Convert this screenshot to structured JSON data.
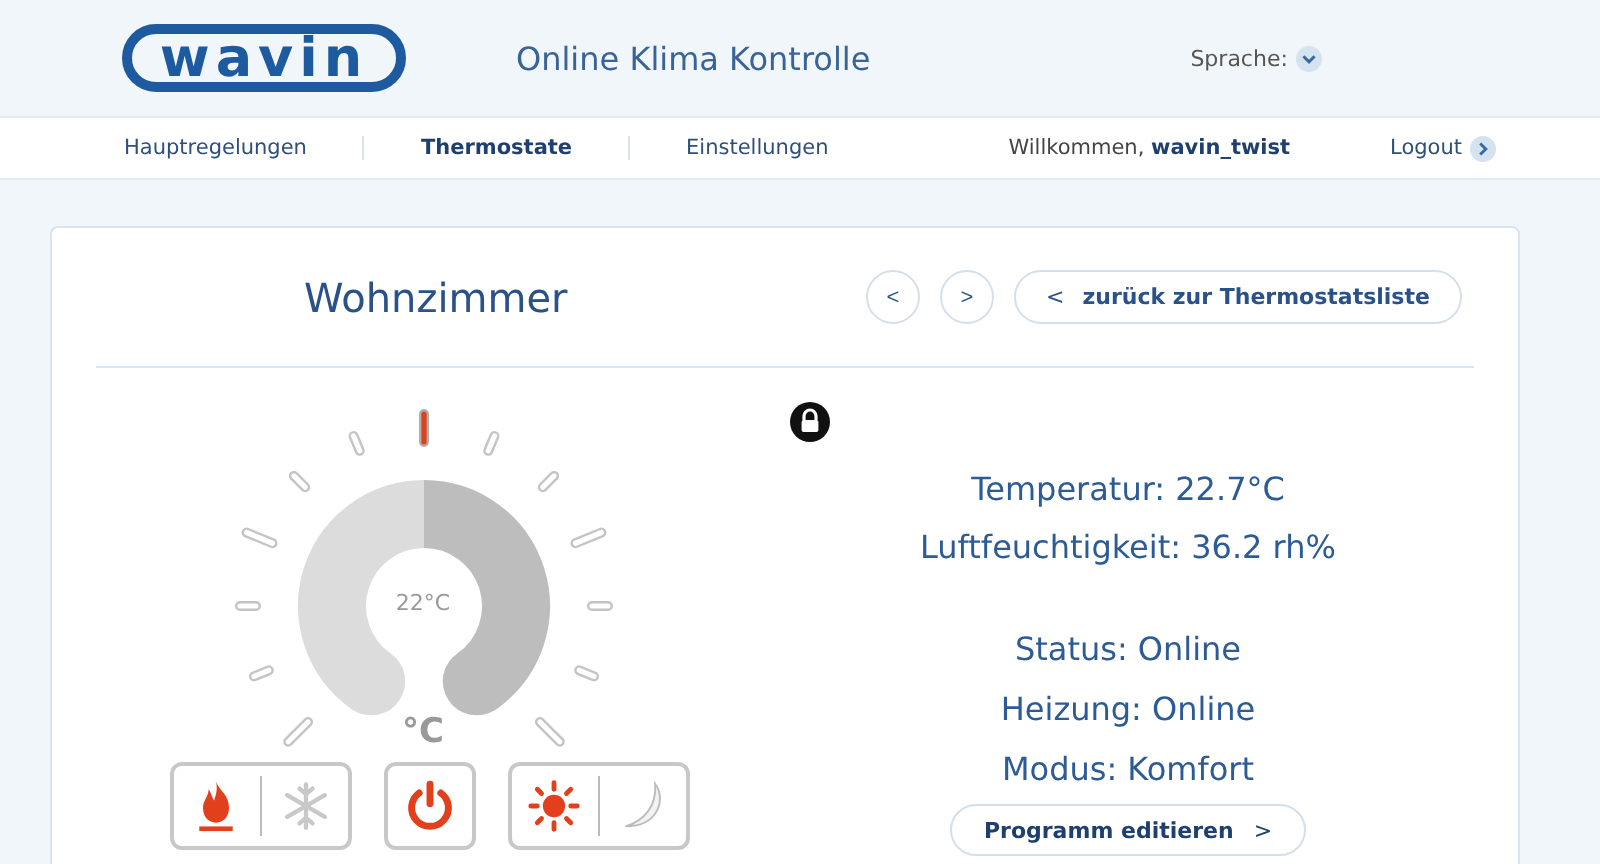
{
  "header": {
    "logo": "wavin",
    "title": "Online Klima Kontrolle",
    "language_label": "Sprache:"
  },
  "nav": {
    "items": [
      {
        "label": "Hauptregelungen",
        "selected": false
      },
      {
        "label": "Thermostate",
        "selected": true
      },
      {
        "label": "Einstellungen",
        "selected": false
      }
    ],
    "welcome": "Willkommen,",
    "user": "wavin_twist",
    "logout": "Logout"
  },
  "room": {
    "title": "Wohnzimmer",
    "prev": "<",
    "next": ">",
    "back_arrow": "<",
    "back": "zurück zur Thermostatsliste"
  },
  "dial": {
    "setpoint": "22°C",
    "unit": "°C",
    "locked": true
  },
  "mode_toggles": [
    {
      "kind": "heat",
      "selected": true
    },
    {
      "kind": "cool",
      "selected": false
    }
  ],
  "power": {
    "on": true
  },
  "preset_toggles": [
    {
      "kind": "comfort",
      "selected": true
    },
    {
      "kind": "eco",
      "selected": false
    }
  ],
  "readings": [
    "Temperatur: 22.7°C",
    "Luftfeuchtigkeit: 36.2 rh%"
  ],
  "status": [
    "Status: Online",
    "Heizung: Online",
    "Modus: Komfort"
  ],
  "program_button": {
    "label": "Programm editieren",
    "arrow": ">"
  }
}
